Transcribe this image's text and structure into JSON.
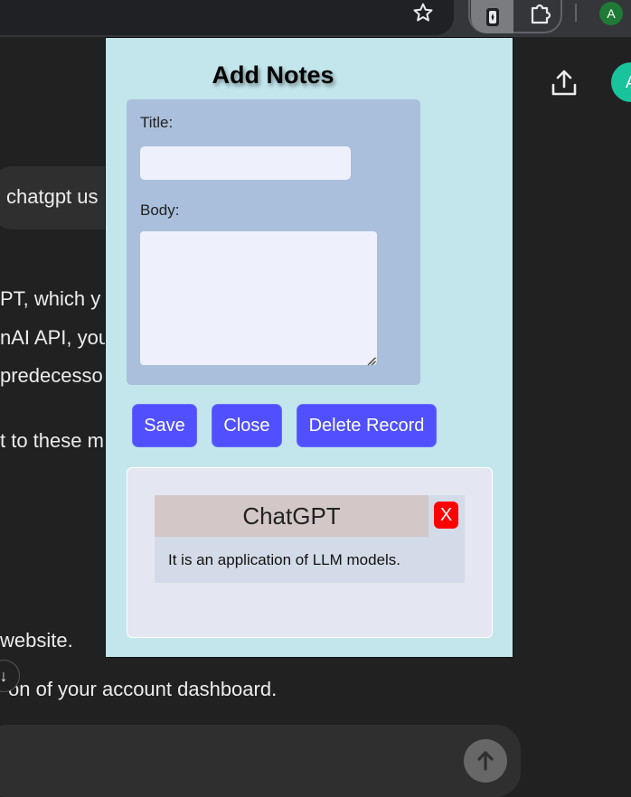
{
  "browser": {
    "profile_initial": "A",
    "icons": [
      "star-icon",
      "extension-active-icon",
      "puzzle-icon"
    ]
  },
  "chat": {
    "user_query_fragment": "chatgpt us",
    "lines": [
      "PT, which y",
      "nAI API, you",
      " predecesso",
      "t to these m",
      " website.",
      "on of your account dashboard."
    ],
    "avatar_initial": "A"
  },
  "popup": {
    "title": "Add Notes",
    "form": {
      "title_label": "Title:",
      "title_value": "",
      "body_label": "Body:",
      "body_value": ""
    },
    "buttons": {
      "save": "Save",
      "close": "Close",
      "delete": "Delete Record"
    },
    "notes": [
      {
        "title": "ChatGPT",
        "body": "It is an application of LLM models.",
        "delete_label": "X"
      }
    ]
  },
  "colors": {
    "popup_bg": "#c2e6ec",
    "form_panel": "#a9bfdb",
    "button": "#5050ff",
    "note_delete": "#ff0000"
  }
}
